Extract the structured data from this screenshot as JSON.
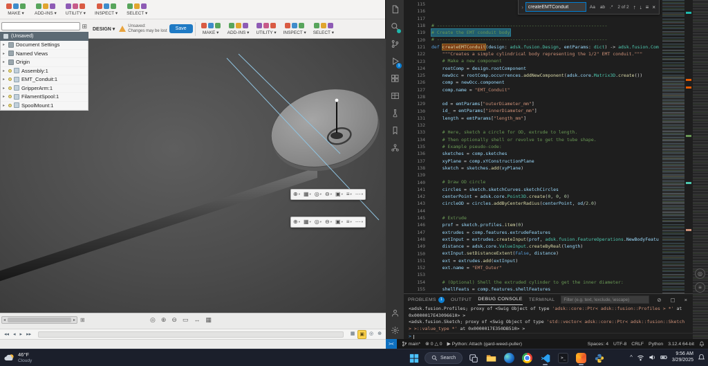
{
  "glyphs": {
    "caret": "▾",
    "tree": "▸",
    "close": "×",
    "up": "↑",
    "down": "↓",
    "menu": "≡",
    "chev": "›",
    "err": "⊗",
    "warn": "△",
    "play": "▶",
    "grid": "⊞",
    "left": "◂",
    "right": "▸",
    "clear": "⊘",
    "square": "▢",
    "chevup": "^",
    "term_glyph": ">_",
    "remote": "><",
    "refresh": "◎"
  },
  "fusion": {
    "icon_palette": [
      "#d95b43",
      "#3f8ccb",
      "#58a55c",
      "#e0a62f",
      "#8e5bb5",
      "#c75b8a"
    ],
    "toolbar_top": {
      "tabs": [
        {
          "label": "MAKE"
        },
        {
          "label": "ADD-INS"
        },
        {
          "label": "UTILITY"
        },
        {
          "label": "INSPECT"
        },
        {
          "label": "SELECT"
        }
      ]
    },
    "toolbar_main": {
      "design_tab": "DESIGN ▾",
      "unsaved_line1": "Unsaved:",
      "unsaved_line2": "Changes may be lost",
      "save_label": "Save",
      "tabs": [
        {
          "label": "MAKE"
        },
        {
          "label": "ADD-INS"
        },
        {
          "label": "UTILITY"
        },
        {
          "label": "INSPECT"
        },
        {
          "label": "SELECT"
        }
      ]
    },
    "browser": {
      "header_label": "(Unsaved)",
      "items": [
        {
          "label": "Document Settings",
          "kind": "folder"
        },
        {
          "label": "Named Views",
          "kind": "folder"
        },
        {
          "label": "Origin",
          "kind": "folder"
        },
        {
          "label": "Assembly:1",
          "kind": "component"
        },
        {
          "label": "EMT_Conduit:1",
          "kind": "component"
        },
        {
          "label": "GripperArm:1",
          "kind": "component"
        },
        {
          "label": "FilamentSpool:1",
          "kind": "component"
        },
        {
          "label": "SpoolMount:1",
          "kind": "component"
        }
      ]
    },
    "view_toolbar_glyphs": [
      "⊕",
      "▦",
      "◎",
      "⊖",
      "▣",
      "≡",
      "⋯"
    ],
    "nav_glyphs": [
      "◎",
      "⊕",
      "⊖",
      "▭",
      "↔",
      "▦"
    ],
    "timeline_play_glyphs": [
      "◂◂",
      "◂",
      "▸",
      "▸▸"
    ],
    "timeline_right_glyphs": [
      "▦",
      "▣",
      "◎",
      "⊕"
    ]
  },
  "vscode": {
    "find": {
      "query": "createEMTConduit",
      "case_label": "Aa",
      "word_label": "ab",
      "regex_label": ".*",
      "match_count": "2 of 2"
    },
    "editor": {
      "lines": [
        {
          "n": 115,
          "t": []
        },
        {
          "n": 116,
          "t": []
        },
        {
          "n": 117,
          "t": []
        },
        {
          "n": 118,
          "t": [
            [
              "c",
              "# ---------------------------------------------------------------"
            ]
          ]
        },
        {
          "n": 119,
          "sel": true,
          "t": [
            [
              "c",
              "# Create the EMT conduit body"
            ]
          ]
        },
        {
          "n": 120,
          "t": [
            [
              "c",
              "# ---------------------------------------------------------------"
            ]
          ]
        },
        {
          "n": 121,
          "t": [
            [
              "k",
              "def "
            ],
            [
              "fm",
              "createEMTConduit"
            ],
            [
              "p",
              "("
            ],
            [
              "v",
              "design"
            ],
            [
              "p",
              ": "
            ],
            [
              "t",
              "adsk.fusion.Design"
            ],
            [
              "p",
              ", "
            ],
            [
              "v",
              "emtParams"
            ],
            [
              "p",
              ": "
            ],
            [
              "t",
              "dict"
            ],
            [
              "p",
              ") -> "
            ],
            [
              "t",
              "adsk.fusion.Com"
            ]
          ]
        },
        {
          "n": 122,
          "t": [
            [
              "s",
              "    \"\"\"Creates a simple cylindrical body representing the 1/2\" EMT conduit.\"\"\""
            ]
          ]
        },
        {
          "n": 123,
          "t": [
            [
              "c",
              "    # Make a new component"
            ]
          ]
        },
        {
          "n": 124,
          "t": [
            [
              "v",
              "    rootComp"
            ],
            [
              "p",
              " = "
            ],
            [
              "v",
              "design.rootComponent"
            ]
          ]
        },
        {
          "n": 125,
          "t": [
            [
              "v",
              "    newOcc"
            ],
            [
              "p",
              " = "
            ],
            [
              "v",
              "rootComp.occurrences"
            ],
            [
              "p",
              "."
            ],
            [
              "f",
              "addNewComponent"
            ],
            [
              "p",
              "("
            ],
            [
              "v",
              "adsk.core"
            ],
            [
              "p",
              "."
            ],
            [
              "t",
              "Matrix3D"
            ],
            [
              "p",
              "."
            ],
            [
              "f",
              "create"
            ],
            [
              "p",
              "())"
            ]
          ]
        },
        {
          "n": 126,
          "t": [
            [
              "v",
              "    comp"
            ],
            [
              "p",
              " = "
            ],
            [
              "v",
              "newOcc.component"
            ]
          ]
        },
        {
          "n": 127,
          "t": [
            [
              "v",
              "    comp.name"
            ],
            [
              "p",
              " = "
            ],
            [
              "s",
              "\"EMT_Conduit\""
            ]
          ]
        },
        {
          "n": 128,
          "t": []
        },
        {
          "n": 129,
          "t": [
            [
              "v",
              "    od"
            ],
            [
              "p",
              " = "
            ],
            [
              "v",
              "emtParams"
            ],
            [
              "p",
              "["
            ],
            [
              "s",
              "\"outerDiameter_mm\""
            ],
            [
              "p",
              "]"
            ]
          ]
        },
        {
          "n": 130,
          "t": [
            [
              "v",
              "    id_"
            ],
            [
              "p",
              " = "
            ],
            [
              "v",
              "emtParams"
            ],
            [
              "p",
              "["
            ],
            [
              "s",
              "\"innerDiameter_mm\""
            ],
            [
              "p",
              "]"
            ]
          ]
        },
        {
          "n": 131,
          "t": [
            [
              "v",
              "    length"
            ],
            [
              "p",
              " = "
            ],
            [
              "v",
              "emtParams"
            ],
            [
              "p",
              "["
            ],
            [
              "s",
              "\"length_mm\""
            ],
            [
              "p",
              "]"
            ]
          ]
        },
        {
          "n": 132,
          "t": []
        },
        {
          "n": 133,
          "t": [
            [
              "c",
              "    # Here, sketch a circle for OD, extrude to length."
            ]
          ]
        },
        {
          "n": 134,
          "t": [
            [
              "c",
              "    # Then optionally shell or revolve to get the tube shape."
            ]
          ]
        },
        {
          "n": 135,
          "t": [
            [
              "c",
              "    # Example pseudo-code:"
            ]
          ]
        },
        {
          "n": 136,
          "t": [
            [
              "v",
              "    sketches"
            ],
            [
              "p",
              " = "
            ],
            [
              "v",
              "comp.sketches"
            ]
          ]
        },
        {
          "n": 137,
          "t": [
            [
              "v",
              "    xyPlane"
            ],
            [
              "p",
              " = "
            ],
            [
              "v",
              "comp.xYConstructionPlane"
            ]
          ]
        },
        {
          "n": 138,
          "t": [
            [
              "v",
              "    sketch"
            ],
            [
              "p",
              " = "
            ],
            [
              "v",
              "sketches"
            ],
            [
              "p",
              "."
            ],
            [
              "f",
              "add"
            ],
            [
              "p",
              "("
            ],
            [
              "v",
              "xyPlane"
            ],
            [
              "p",
              ")"
            ]
          ]
        },
        {
          "n": 139,
          "t": []
        },
        {
          "n": 140,
          "t": [
            [
              "c",
              "    # Draw OD circle"
            ]
          ]
        },
        {
          "n": 141,
          "t": [
            [
              "v",
              "    circles"
            ],
            [
              "p",
              " = "
            ],
            [
              "v",
              "sketch.sketchCurves.sketchCircles"
            ]
          ]
        },
        {
          "n": 142,
          "t": [
            [
              "v",
              "    centerPoint"
            ],
            [
              "p",
              " = "
            ],
            [
              "v",
              "adsk.core"
            ],
            [
              "p",
              "."
            ],
            [
              "t",
              "Point3D"
            ],
            [
              "p",
              "."
            ],
            [
              "f",
              "create"
            ],
            [
              "p",
              "("
            ],
            [
              "n",
              "0"
            ],
            [
              "p",
              ", "
            ],
            [
              "n",
              "0"
            ],
            [
              "p",
              ", "
            ],
            [
              "n",
              "0"
            ],
            [
              "p",
              ")"
            ]
          ]
        },
        {
          "n": 143,
          "t": [
            [
              "v",
              "    circleOD"
            ],
            [
              "p",
              " = "
            ],
            [
              "v",
              "circles"
            ],
            [
              "p",
              "."
            ],
            [
              "f",
              "addByCenterRadius"
            ],
            [
              "p",
              "("
            ],
            [
              "v",
              "centerPoint"
            ],
            [
              "p",
              ", "
            ],
            [
              "v",
              "od"
            ],
            [
              "p",
              "/"
            ],
            [
              "n",
              "2.0"
            ],
            [
              "p",
              ")"
            ]
          ]
        },
        {
          "n": 144,
          "t": []
        },
        {
          "n": 145,
          "t": [
            [
              "c",
              "    # Extrude"
            ]
          ]
        },
        {
          "n": 146,
          "t": [
            [
              "v",
              "    prof"
            ],
            [
              "p",
              " = "
            ],
            [
              "v",
              "sketch.profiles"
            ],
            [
              "p",
              "."
            ],
            [
              "f",
              "item"
            ],
            [
              "p",
              "("
            ],
            [
              "n",
              "0"
            ],
            [
              "p",
              ")"
            ]
          ]
        },
        {
          "n": 147,
          "t": [
            [
              "v",
              "    extrudes"
            ],
            [
              "p",
              " = "
            ],
            [
              "v",
              "comp.features.extrudeFeatures"
            ]
          ]
        },
        {
          "n": 148,
          "t": [
            [
              "v",
              "    extInput"
            ],
            [
              "p",
              " = "
            ],
            [
              "v",
              "extrudes"
            ],
            [
              "p",
              "."
            ],
            [
              "f",
              "createInput"
            ],
            [
              "p",
              "("
            ],
            [
              "v",
              "prof"
            ],
            [
              "p",
              ", "
            ],
            [
              "t",
              "adsk.fusion.FeatureOperations"
            ],
            [
              "p",
              "."
            ],
            [
              "v",
              "NewBodyFeatu"
            ]
          ]
        },
        {
          "n": 149,
          "t": [
            [
              "v",
              "    distance"
            ],
            [
              "p",
              " = "
            ],
            [
              "v",
              "adsk.core"
            ],
            [
              "p",
              "."
            ],
            [
              "t",
              "ValueInput"
            ],
            [
              "p",
              "."
            ],
            [
              "f",
              "createByReal"
            ],
            [
              "p",
              "("
            ],
            [
              "v",
              "length"
            ],
            [
              "p",
              ")"
            ]
          ]
        },
        {
          "n": 150,
          "t": [
            [
              "v",
              "    extInput"
            ],
            [
              "p",
              "."
            ],
            [
              "f",
              "setDistanceExtent"
            ],
            [
              "p",
              "("
            ],
            [
              "k",
              "False"
            ],
            [
              "p",
              ", "
            ],
            [
              "v",
              "distance"
            ],
            [
              "p",
              ")"
            ]
          ]
        },
        {
          "n": 151,
          "t": [
            [
              "v",
              "    ext"
            ],
            [
              "p",
              " = "
            ],
            [
              "v",
              "extrudes"
            ],
            [
              "p",
              "."
            ],
            [
              "f",
              "add"
            ],
            [
              "p",
              "("
            ],
            [
              "v",
              "extInput"
            ],
            [
              "p",
              ")"
            ]
          ]
        },
        {
          "n": 152,
          "t": [
            [
              "v",
              "    ext.name"
            ],
            [
              "p",
              " = "
            ],
            [
              "s",
              "\"EMT_Outer\""
            ]
          ]
        },
        {
          "n": 153,
          "t": []
        },
        {
          "n": 154,
          "t": [
            [
              "c",
              "    # (Optional) Shell the extruded cylinder to get the inner diameter:"
            ]
          ]
        },
        {
          "n": 155,
          "t": [
            [
              "v",
              "    shellFeats"
            ],
            [
              "p",
              " = "
            ],
            [
              "v",
              "comp.features.shellFeatures"
            ]
          ]
        }
      ]
    },
    "panel": {
      "tabs": [
        {
          "label": "PROBLEMS",
          "badge": "1"
        },
        {
          "label": "OUTPUT"
        },
        {
          "label": "DEBUG CONSOLE",
          "active": true
        },
        {
          "label": "TERMINAL"
        }
      ],
      "filter_placeholder": "Filter (e.g. text, !exclude, \\escape)",
      "console_lines": [
        [
          [
            "p",
            "<adsk.fusion.Profiles; proxy of <Swig Object of type "
          ],
          [
            "s",
            "'adsk::core::Ptr< adsk::fusion::Profiles > *'"
          ],
          [
            "p",
            " at"
          ]
        ],
        [
          [
            "p",
            "0x0000017E43096610> >"
          ]
        ],
        [
          [
            "p",
            "<adsk.fusion.Sketch; proxy of <Swig Object of type "
          ],
          [
            "s",
            "'std::vector< adsk::core::Ptr< adsk::fusion::Sketch"
          ]
        ],
        [
          [
            "s",
            "> >::value_type *'"
          ],
          [
            "p",
            " at 0x0000017E350DB510> >"
          ]
        ]
      ],
      "prompt": ">"
    },
    "activity": {
      "debug_badge": "1"
    },
    "status_bar": {
      "branch": "main*",
      "errors": "0",
      "warnings": "0",
      "debug_label": "Python: Attach (gard-weed-puller)",
      "spaces": "Spaces: 4",
      "encoding": "UTF-8",
      "eol": "CRLF",
      "language": "Python",
      "interpreter": "3.12.4 64-bit"
    }
  },
  "taskbar": {
    "weather": {
      "temp": "46°F",
      "condition": "Cloudy"
    },
    "search_placeholder": "Search",
    "clock": {
      "time": "9:56 AM",
      "date": "3/29/2025"
    }
  }
}
